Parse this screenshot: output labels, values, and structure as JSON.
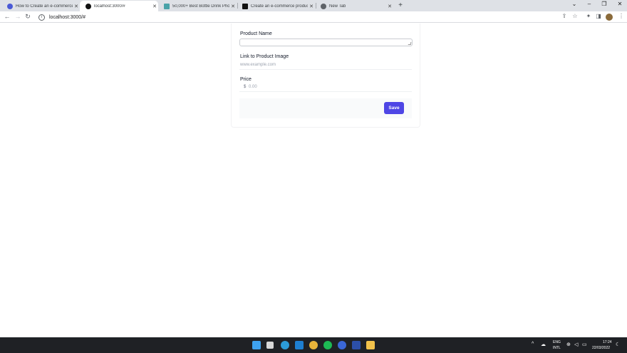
{
  "browser": {
    "tabs": [
      {
        "title": "How to Create an e-commerce p",
        "favicon_color": "#4a5ad6",
        "active": false
      },
      {
        "title": "localhost:3000/#",
        "favicon_color": "#111111",
        "active": true
      },
      {
        "title": "50,000+ Best Bottle Drink Photo",
        "favicon_color": "#4aa3a8",
        "active": false
      },
      {
        "title": "Create an e-commerce product",
        "favicon_color": "#111111",
        "active": false
      },
      {
        "title": "New Tab",
        "favicon_color": "#5f6368",
        "active": false
      }
    ],
    "new_tab_glyph": "+",
    "url": "localhost:3000/#"
  },
  "form": {
    "product_name_label": "Product Name",
    "product_name_value": "",
    "image_link_label": "Link to Product Image",
    "image_link_placeholder": "www.example.com",
    "price_label": "Price",
    "price_currency": "$",
    "price_placeholder": "0.00",
    "save_label": "Save",
    "accent_color": "#4f46e5"
  },
  "taskbar": {
    "language": "ENG",
    "layout": "INTL",
    "time": "17:24",
    "date": "22/03/2022"
  }
}
